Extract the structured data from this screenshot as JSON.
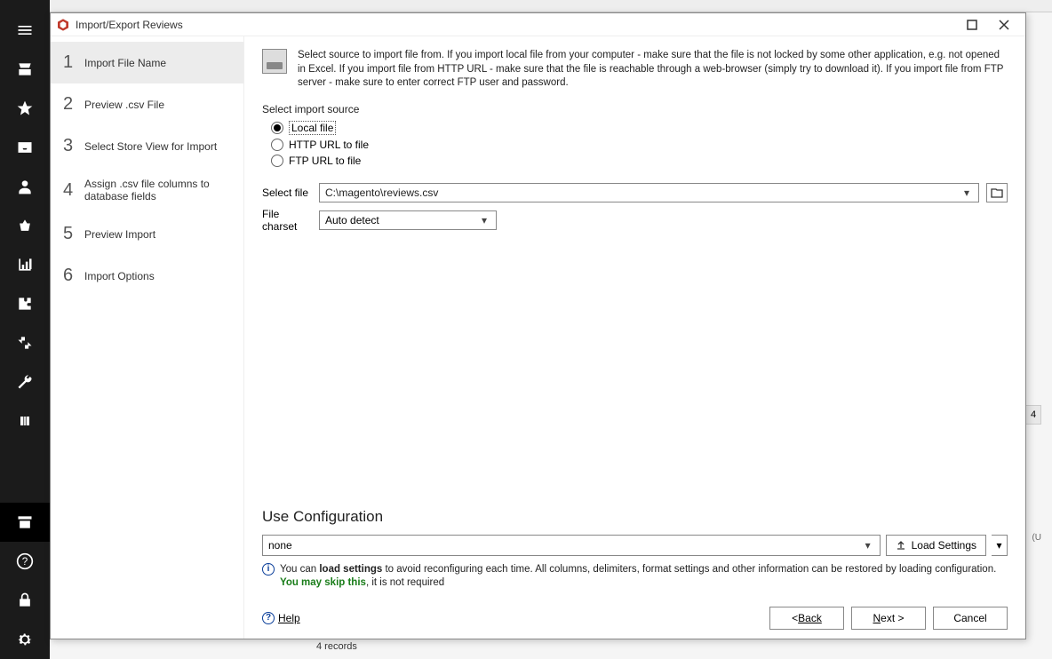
{
  "dialog": {
    "title": "Import/Export Reviews",
    "steps": [
      {
        "num": "1",
        "label": "Import File Name"
      },
      {
        "num": "2",
        "label": "Preview .csv File"
      },
      {
        "num": "3",
        "label": "Select Store View for Import"
      },
      {
        "num": "4",
        "label": "Assign .csv file columns to database fields"
      },
      {
        "num": "5",
        "label": "Preview Import"
      },
      {
        "num": "6",
        "label": "Import Options"
      }
    ],
    "active_step": 0,
    "info_text": "Select source to import file from. If you import local file from your computer - make sure that the file is not locked by some other application, e.g. not opened in Excel. If you import file from HTTP URL - make sure that the file is reachable through a web-browser (simply try to download it). If you import file from FTP server - make sure to enter correct FTP user and password.",
    "source_label": "Select import source",
    "sources": [
      {
        "label": "Local file",
        "selected": true
      },
      {
        "label": "HTTP URL to file",
        "selected": false
      },
      {
        "label": "FTP URL to file",
        "selected": false
      }
    ],
    "select_file_label": "Select file",
    "select_file_value": "C:\\magento\\reviews.csv",
    "charset_label": "File charset",
    "charset_value": "Auto detect",
    "use_config_heading": "Use Configuration",
    "config_value": "none",
    "load_settings_label": "Load Settings",
    "tip_pre": "You can ",
    "tip_bold": "load settings",
    "tip_mid": " to avoid reconfiguring each time. All columns, delimiters, format settings and other information can be restored by loading configuration. ",
    "tip_green": "You may skip this",
    "tip_post": ", it is not required",
    "help_label": "Help",
    "back_label": "Back",
    "next_label": "Next >",
    "cancel_label": "Cancel"
  },
  "background": {
    "records": "4 records",
    "badge": "4",
    "txt": "(U"
  }
}
